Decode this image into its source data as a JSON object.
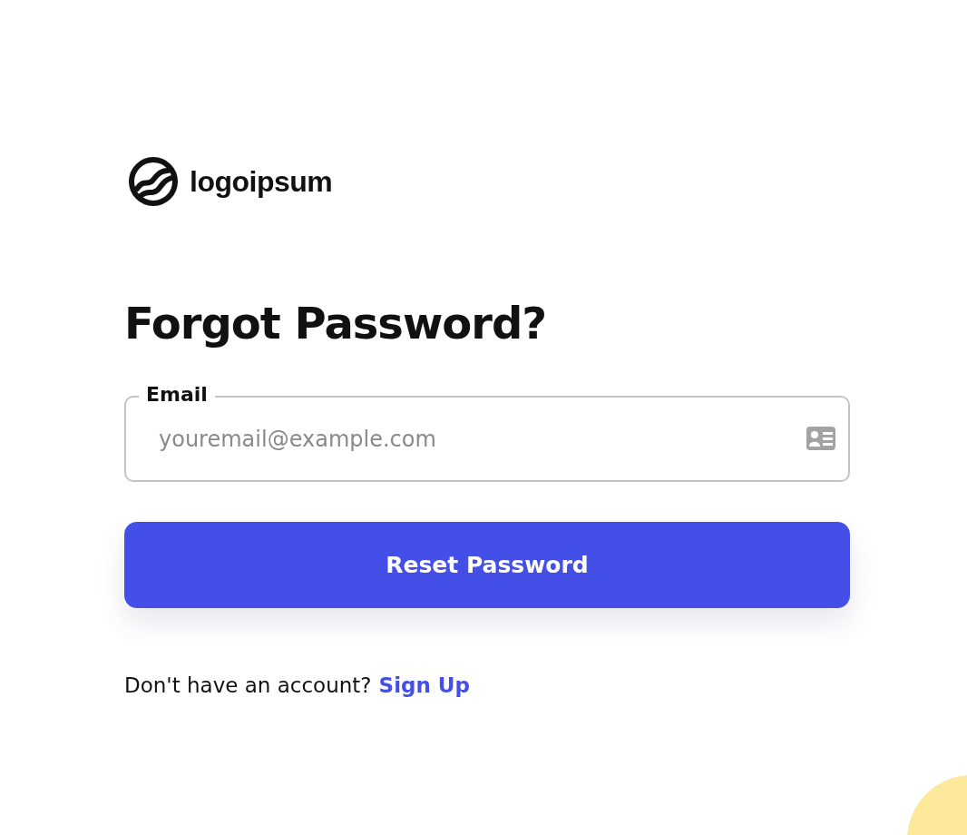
{
  "logo": {
    "text": "logoipsum"
  },
  "heading": "Forgot Password?",
  "email_field": {
    "label": "Email",
    "placeholder": "youremail@example.com"
  },
  "submit_button": "Reset Password",
  "footer": {
    "prompt": "Don't have an account?",
    "link": "Sign Up"
  }
}
